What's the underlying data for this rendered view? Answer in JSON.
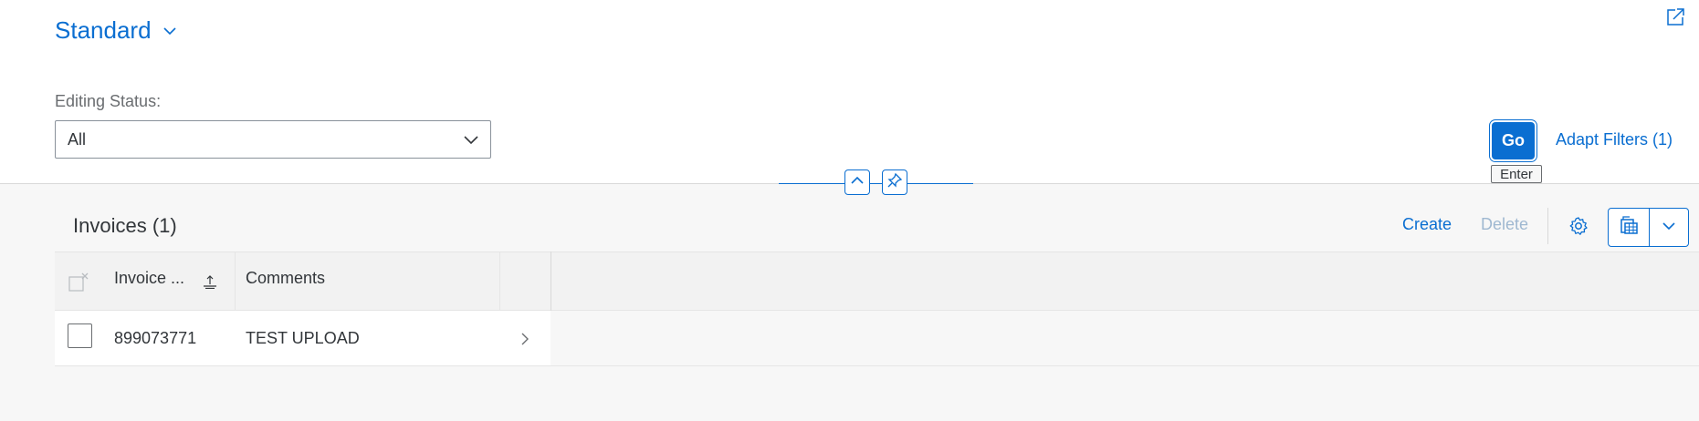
{
  "header": {
    "variant_title": "Standard",
    "filter_label": "Editing Status:",
    "editing_status_value": "All",
    "go_label": "Go",
    "go_tooltip": "Enter",
    "adapt_filters_label": "Adapt Filters (1)"
  },
  "icons": {
    "variant": "chevron-down-icon",
    "share": "share-icon",
    "select": "chevron-down-icon",
    "collapse": "chevron-up-icon",
    "pin": "pin-icon",
    "settings": "gear-icon",
    "export": "spreadsheet-export-icon",
    "export_menu": "chevron-down-icon",
    "sort": "sort-icon",
    "navigation": "chevron-right-icon",
    "select_all": "clear-selection-icon"
  },
  "table": {
    "title": "Invoices (1)",
    "toolbar": {
      "create_label": "Create",
      "delete_label": "Delete"
    },
    "columns": [
      "Invoice ...",
      "Comments"
    ],
    "rows": [
      {
        "invoice": "899073771",
        "comments": "TEST UPLOAD"
      }
    ]
  },
  "colors": {
    "accent": "#0a6ed1",
    "background": "#f7f7f7",
    "text": "#32363a",
    "disabled_link": "#9fb8d1"
  }
}
